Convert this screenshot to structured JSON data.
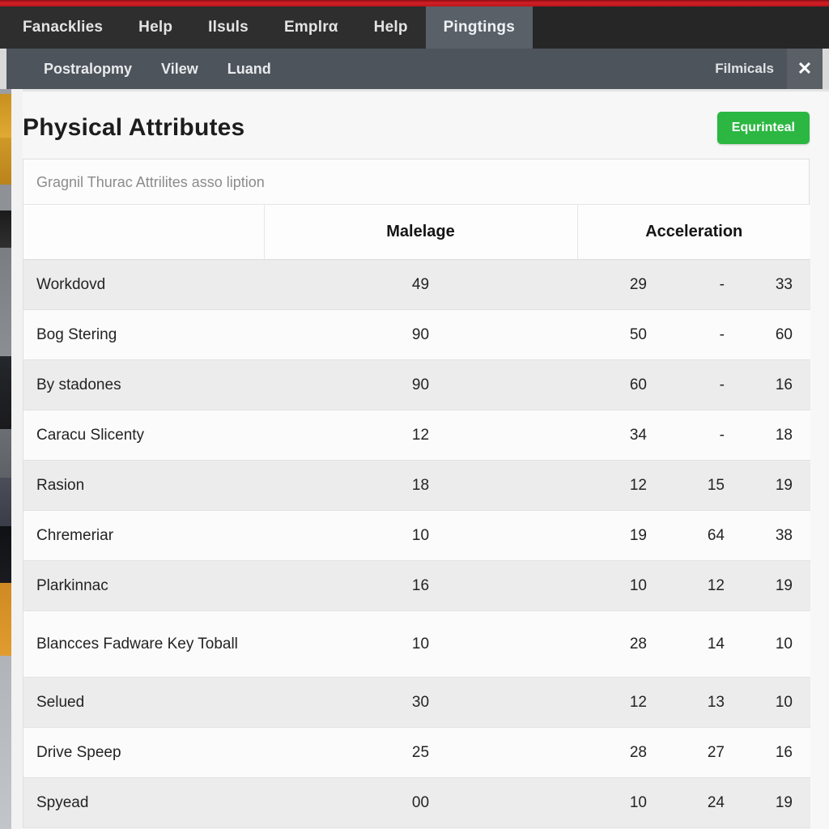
{
  "window": {
    "accent_red": "#d31f26",
    "tabs": [
      {
        "label": "Fanacklies",
        "active": false
      },
      {
        "label": "Help",
        "active": false
      },
      {
        "label": "Ilsuls",
        "active": false
      },
      {
        "label": "Emplrα",
        "active": false
      },
      {
        "label": "Help",
        "active": false
      },
      {
        "label": "Pingtings",
        "active": true
      }
    ],
    "toolbar": {
      "items": [
        "Postralopmy",
        "Vilew",
        "Luand"
      ],
      "right_label": "Filmicals",
      "close_icon": "✕"
    }
  },
  "page": {
    "title": "Physical Attributes",
    "primary_button": "Equrinteal",
    "accent_green": "#2cb742"
  },
  "table": {
    "caption": "Gragnil Thurac Attrilites asso liption",
    "headers": [
      "",
      "Malelage",
      "Acceleration"
    ],
    "rows": [
      {
        "label": "Workdovd",
        "v1": "49",
        "v2": "29",
        "v3": "-",
        "v4": "33"
      },
      {
        "label": "Bog Stering",
        "v1": "90",
        "v2": "50",
        "v3": "-",
        "v4": "60"
      },
      {
        "label": "By stadones",
        "v1": "90",
        "v2": "60",
        "v3": "-",
        "v4": "16"
      },
      {
        "label": "Caracu Slicenty",
        "v1": "12",
        "v2": "34",
        "v3": "-",
        "v4": "18"
      },
      {
        "label": "Rasion",
        "v1": "18",
        "v2": "12",
        "v3": "15",
        "v4": "19"
      },
      {
        "label": "Chremeriar",
        "v1": "10",
        "v2": "19",
        "v3": "64",
        "v4": "38"
      },
      {
        "label": "Plarkinnac",
        "v1": "16",
        "v2": "10",
        "v3": "12",
        "v4": "19"
      },
      {
        "label": "Blancces Fadware Key Toball",
        "v1": "10",
        "v2": "28",
        "v3": "14",
        "v4": "10"
      },
      {
        "label": "Selued",
        "v1": "30",
        "v2": "12",
        "v3": "13",
        "v4": "10"
      },
      {
        "label": "Drive Speep",
        "v1": "25",
        "v2": "28",
        "v3": "27",
        "v4": "16"
      },
      {
        "label": "Spyead",
        "v1": "00",
        "v2": "10",
        "v3": "24",
        "v4": "19"
      }
    ]
  }
}
